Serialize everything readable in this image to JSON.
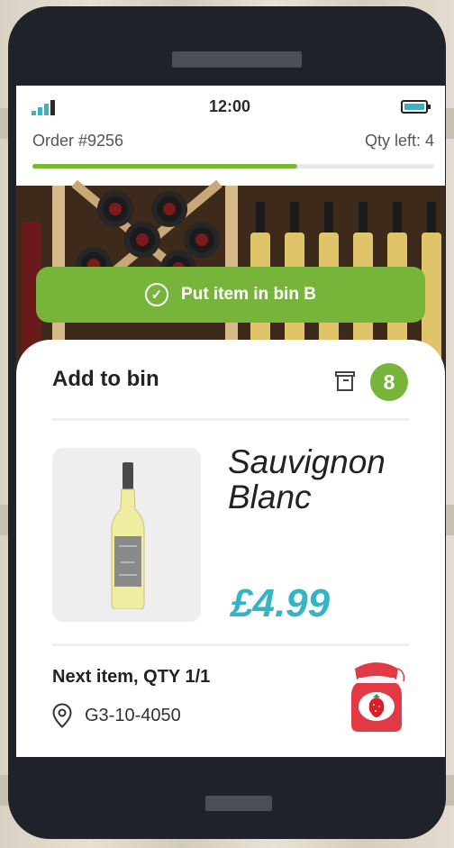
{
  "status_bar": {
    "time": "12:00",
    "signal_icon": "signal-icon",
    "battery_icon": "battery-icon"
  },
  "order": {
    "number_label": "Order #9256",
    "qty_left_label": "Qty left: 4",
    "progress_fraction": 0.66
  },
  "action": {
    "label": "Put item in bin B",
    "icon": "check-circle-icon",
    "color": "#77b43a"
  },
  "bin": {
    "title": "Add to bin",
    "icon": "bin-icon",
    "count": "8"
  },
  "product": {
    "name": "Sauvignon Blanc",
    "price": "£4.99",
    "price_color": "#35b4c6"
  },
  "next_item": {
    "label": "Next item, QTY 1/1",
    "location": "G3-10-4050",
    "location_icon": "map-pin-icon",
    "thumbnail_icon": "jam-jar-icon"
  }
}
